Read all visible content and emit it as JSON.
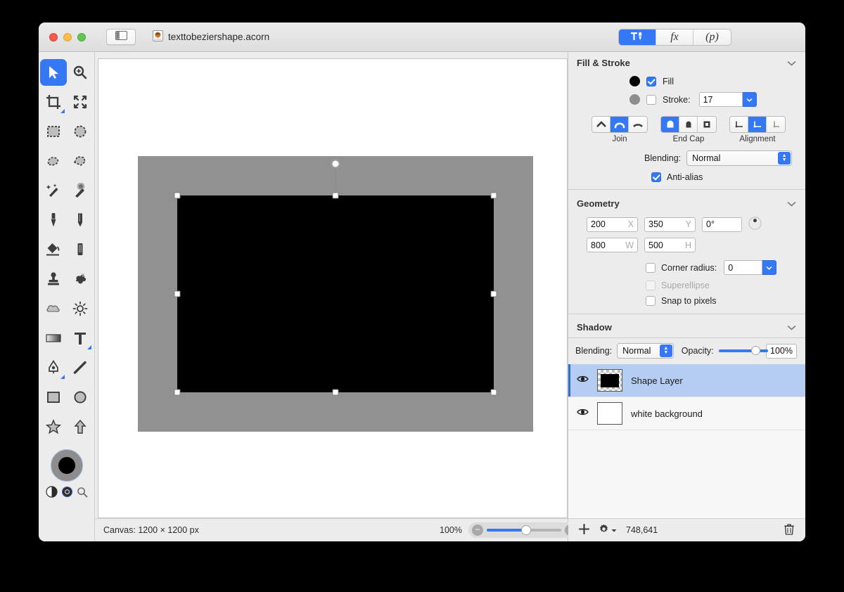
{
  "window": {
    "document_title": "texttobeziershape.acorn",
    "doc_icon": "acorn-document-icon",
    "sidebar_toggle_icon": "sidebar-toggle-icon",
    "traffic_lights": [
      "close-button",
      "minimize-button",
      "zoom-button"
    ]
  },
  "toolbar_segments": [
    {
      "name": "tools-inspector",
      "label": "",
      "icon": "hammer-pen-icon",
      "active": true
    },
    {
      "name": "filters-inspector",
      "label": "fx",
      "icon": "fx-icon",
      "active": false
    },
    {
      "name": "palette-inspector",
      "label": "(p)",
      "icon": "p-icon",
      "active": false
    }
  ],
  "tools": [
    {
      "name": "move-tool",
      "icon": "cursor-arrow-icon",
      "active": true
    },
    {
      "name": "zoom-tool",
      "icon": "magnifier-plus-icon",
      "active": false
    },
    {
      "name": "crop-tool",
      "icon": "crop-icon",
      "active": false,
      "has_options": true
    },
    {
      "name": "transform-tool",
      "icon": "four-arrows-icon",
      "active": false
    },
    {
      "name": "rect-select-tool",
      "icon": "rectangle-marquee-icon",
      "active": false
    },
    {
      "name": "ellipse-select-tool",
      "icon": "ellipse-marquee-icon",
      "active": false
    },
    {
      "name": "lasso-tool",
      "icon": "lasso-icon",
      "active": false
    },
    {
      "name": "polygon-lasso-tool",
      "icon": "polygon-lasso-icon",
      "active": false
    },
    {
      "name": "magic-wand-tool",
      "icon": "magic-wand-icon",
      "active": false
    },
    {
      "name": "instant-alpha-tool",
      "icon": "sparkle-wand-icon",
      "active": false
    },
    {
      "name": "brush-tool",
      "icon": "brush-icon",
      "active": false
    },
    {
      "name": "pencil-tool",
      "icon": "pencil-icon",
      "active": false
    },
    {
      "name": "paint-bucket-tool",
      "icon": "paint-bucket-icon",
      "active": false
    },
    {
      "name": "eraser-tool",
      "icon": "eraser-icon",
      "active": false
    },
    {
      "name": "clone-stamp-tool",
      "icon": "clone-stamp-icon",
      "active": false
    },
    {
      "name": "smudge-tool",
      "icon": "smudge-splat-icon",
      "active": false
    },
    {
      "name": "dodge-tool",
      "icon": "cloud-icon",
      "active": false
    },
    {
      "name": "burn-tool",
      "icon": "sun-icon",
      "active": false
    },
    {
      "name": "gradient-tool",
      "icon": "gradient-icon",
      "active": false
    },
    {
      "name": "text-tool",
      "icon": "text-t-icon",
      "active": false,
      "has_options": true
    },
    {
      "name": "bezier-pen-tool",
      "icon": "pen-nib-icon",
      "active": false,
      "has_options": true
    },
    {
      "name": "line-tool",
      "icon": "line-icon",
      "active": false
    },
    {
      "name": "rectangle-tool",
      "icon": "square-icon",
      "active": false
    },
    {
      "name": "ellipse-tool",
      "icon": "circle-icon",
      "active": false
    },
    {
      "name": "star-tool",
      "icon": "star-icon",
      "active": false
    },
    {
      "name": "arrow-tool",
      "icon": "arrow-up-icon",
      "active": false
    }
  ],
  "color_well": {
    "name": "foreground-background-color-well",
    "fill_color": "#000000",
    "stroke_color": "#8d8d8d",
    "swap_icon": "swap-colors-icon",
    "reset_icon": "reset-colors-icon",
    "loupe_icon": "color-loupe-icon"
  },
  "canvas": {
    "artboard_bg": "#919191",
    "shape_color": "#000000",
    "handles": "selection-handles",
    "rotation_handle": "rotation-handle"
  },
  "statusbar": {
    "canvas_label": "Canvas: 1200 × 1200 px",
    "zoom_level": "100%",
    "zoom_out_icon": "zoom-out-icon",
    "zoom_in_icon": "zoom-in-icon",
    "add_layer_icon": "add-layer-icon",
    "gear_icon": "gear-menu-icon",
    "coordinates": "748,641",
    "trash_icon": "delete-layer-icon"
  },
  "fill_stroke": {
    "title": "Fill & Stroke",
    "collapse_icon": "chevron-down-icon",
    "fill": {
      "label": "Fill",
      "checked": true,
      "color": "#000000"
    },
    "stroke": {
      "label": "Stroke:",
      "checked": false,
      "color": "#8d8d8d",
      "width": "17"
    },
    "join": {
      "label": "Join",
      "options": [
        "miter-join-icon",
        "round-join-icon",
        "bevel-join-icon"
      ],
      "selected": 1
    },
    "end_cap": {
      "label": "End Cap",
      "options": [
        "round-cap-icon",
        "butt-cap-icon",
        "square-cap-icon"
      ],
      "selected": 0
    },
    "alignment": {
      "label": "Alignment",
      "options": [
        "align-inner-icon",
        "align-center-icon",
        "align-outer-icon"
      ],
      "selected": 1
    },
    "blending": {
      "label": "Blending:",
      "value": "Normal"
    },
    "antialias": {
      "label": "Anti-alias",
      "checked": true
    }
  },
  "geometry": {
    "title": "Geometry",
    "collapse_icon": "chevron-down-icon",
    "x": {
      "value": "200",
      "unit": "X"
    },
    "y": {
      "value": "350",
      "unit": "Y"
    },
    "rotation": {
      "value": "0°"
    },
    "rotation_dial_icon": "rotation-dial-icon",
    "w": {
      "value": "800",
      "unit": "W"
    },
    "h": {
      "value": "500",
      "unit": "H"
    },
    "corner_radius": {
      "label": "Corner radius:",
      "checked": false,
      "value": "0"
    },
    "superellipse": {
      "label": "Superellipse",
      "checked": false,
      "disabled": true
    },
    "snap_to_pixels": {
      "label": "Snap to pixels",
      "checked": false
    }
  },
  "shadow": {
    "title": "Shadow",
    "collapse_icon": "chevron-down-icon",
    "blending": {
      "label": "Blending:",
      "value": "Normal"
    },
    "opacity": {
      "label": "Opacity:",
      "value": "100%"
    }
  },
  "layers": [
    {
      "name": "Shape Layer",
      "visible": true,
      "selected": true,
      "thumb": "shape-thumbnail",
      "eye_icon": "eye-icon"
    },
    {
      "name": "white background",
      "visible": true,
      "selected": false,
      "thumb": "white-thumbnail",
      "eye_icon": "eye-icon"
    }
  ]
}
